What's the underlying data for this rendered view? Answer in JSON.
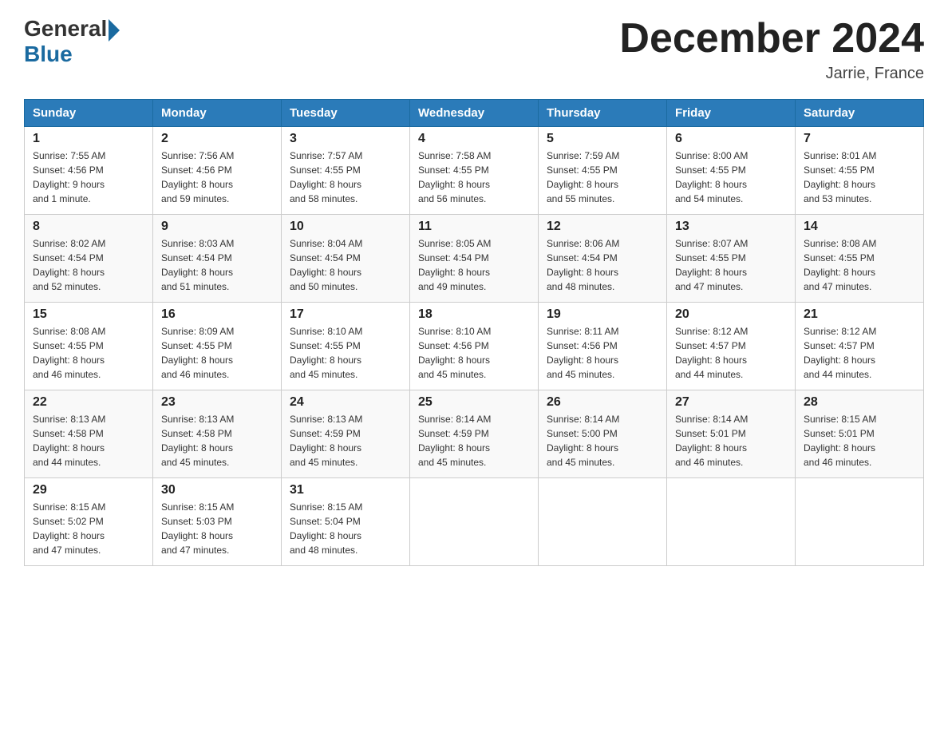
{
  "header": {
    "logo_general": "General",
    "logo_blue": "Blue",
    "month_title": "December 2024",
    "location": "Jarrie, France"
  },
  "days_of_week": [
    "Sunday",
    "Monday",
    "Tuesday",
    "Wednesday",
    "Thursday",
    "Friday",
    "Saturday"
  ],
  "weeks": [
    [
      {
        "day": "1",
        "sunrise": "7:55 AM",
        "sunset": "4:56 PM",
        "daylight": "9 hours and 1 minute."
      },
      {
        "day": "2",
        "sunrise": "7:56 AM",
        "sunset": "4:56 PM",
        "daylight": "8 hours and 59 minutes."
      },
      {
        "day": "3",
        "sunrise": "7:57 AM",
        "sunset": "4:55 PM",
        "daylight": "8 hours and 58 minutes."
      },
      {
        "day": "4",
        "sunrise": "7:58 AM",
        "sunset": "4:55 PM",
        "daylight": "8 hours and 56 minutes."
      },
      {
        "day": "5",
        "sunrise": "7:59 AM",
        "sunset": "4:55 PM",
        "daylight": "8 hours and 55 minutes."
      },
      {
        "day": "6",
        "sunrise": "8:00 AM",
        "sunset": "4:55 PM",
        "daylight": "8 hours and 54 minutes."
      },
      {
        "day": "7",
        "sunrise": "8:01 AM",
        "sunset": "4:55 PM",
        "daylight": "8 hours and 53 minutes."
      }
    ],
    [
      {
        "day": "8",
        "sunrise": "8:02 AM",
        "sunset": "4:54 PM",
        "daylight": "8 hours and 52 minutes."
      },
      {
        "day": "9",
        "sunrise": "8:03 AM",
        "sunset": "4:54 PM",
        "daylight": "8 hours and 51 minutes."
      },
      {
        "day": "10",
        "sunrise": "8:04 AM",
        "sunset": "4:54 PM",
        "daylight": "8 hours and 50 minutes."
      },
      {
        "day": "11",
        "sunrise": "8:05 AM",
        "sunset": "4:54 PM",
        "daylight": "8 hours and 49 minutes."
      },
      {
        "day": "12",
        "sunrise": "8:06 AM",
        "sunset": "4:54 PM",
        "daylight": "8 hours and 48 minutes."
      },
      {
        "day": "13",
        "sunrise": "8:07 AM",
        "sunset": "4:55 PM",
        "daylight": "8 hours and 47 minutes."
      },
      {
        "day": "14",
        "sunrise": "8:08 AM",
        "sunset": "4:55 PM",
        "daylight": "8 hours and 47 minutes."
      }
    ],
    [
      {
        "day": "15",
        "sunrise": "8:08 AM",
        "sunset": "4:55 PM",
        "daylight": "8 hours and 46 minutes."
      },
      {
        "day": "16",
        "sunrise": "8:09 AM",
        "sunset": "4:55 PM",
        "daylight": "8 hours and 46 minutes."
      },
      {
        "day": "17",
        "sunrise": "8:10 AM",
        "sunset": "4:55 PM",
        "daylight": "8 hours and 45 minutes."
      },
      {
        "day": "18",
        "sunrise": "8:10 AM",
        "sunset": "4:56 PM",
        "daylight": "8 hours and 45 minutes."
      },
      {
        "day": "19",
        "sunrise": "8:11 AM",
        "sunset": "4:56 PM",
        "daylight": "8 hours and 45 minutes."
      },
      {
        "day": "20",
        "sunrise": "8:12 AM",
        "sunset": "4:57 PM",
        "daylight": "8 hours and 44 minutes."
      },
      {
        "day": "21",
        "sunrise": "8:12 AM",
        "sunset": "4:57 PM",
        "daylight": "8 hours and 44 minutes."
      }
    ],
    [
      {
        "day": "22",
        "sunrise": "8:13 AM",
        "sunset": "4:58 PM",
        "daylight": "8 hours and 44 minutes."
      },
      {
        "day": "23",
        "sunrise": "8:13 AM",
        "sunset": "4:58 PM",
        "daylight": "8 hours and 45 minutes."
      },
      {
        "day": "24",
        "sunrise": "8:13 AM",
        "sunset": "4:59 PM",
        "daylight": "8 hours and 45 minutes."
      },
      {
        "day": "25",
        "sunrise": "8:14 AM",
        "sunset": "4:59 PM",
        "daylight": "8 hours and 45 minutes."
      },
      {
        "day": "26",
        "sunrise": "8:14 AM",
        "sunset": "5:00 PM",
        "daylight": "8 hours and 45 minutes."
      },
      {
        "day": "27",
        "sunrise": "8:14 AM",
        "sunset": "5:01 PM",
        "daylight": "8 hours and 46 minutes."
      },
      {
        "day": "28",
        "sunrise": "8:15 AM",
        "sunset": "5:01 PM",
        "daylight": "8 hours and 46 minutes."
      }
    ],
    [
      {
        "day": "29",
        "sunrise": "8:15 AM",
        "sunset": "5:02 PM",
        "daylight": "8 hours and 47 minutes."
      },
      {
        "day": "30",
        "sunrise": "8:15 AM",
        "sunset": "5:03 PM",
        "daylight": "8 hours and 47 minutes."
      },
      {
        "day": "31",
        "sunrise": "8:15 AM",
        "sunset": "5:04 PM",
        "daylight": "8 hours and 48 minutes."
      },
      null,
      null,
      null,
      null
    ]
  ],
  "labels": {
    "sunrise": "Sunrise:",
    "sunset": "Sunset:",
    "daylight": "Daylight:"
  }
}
